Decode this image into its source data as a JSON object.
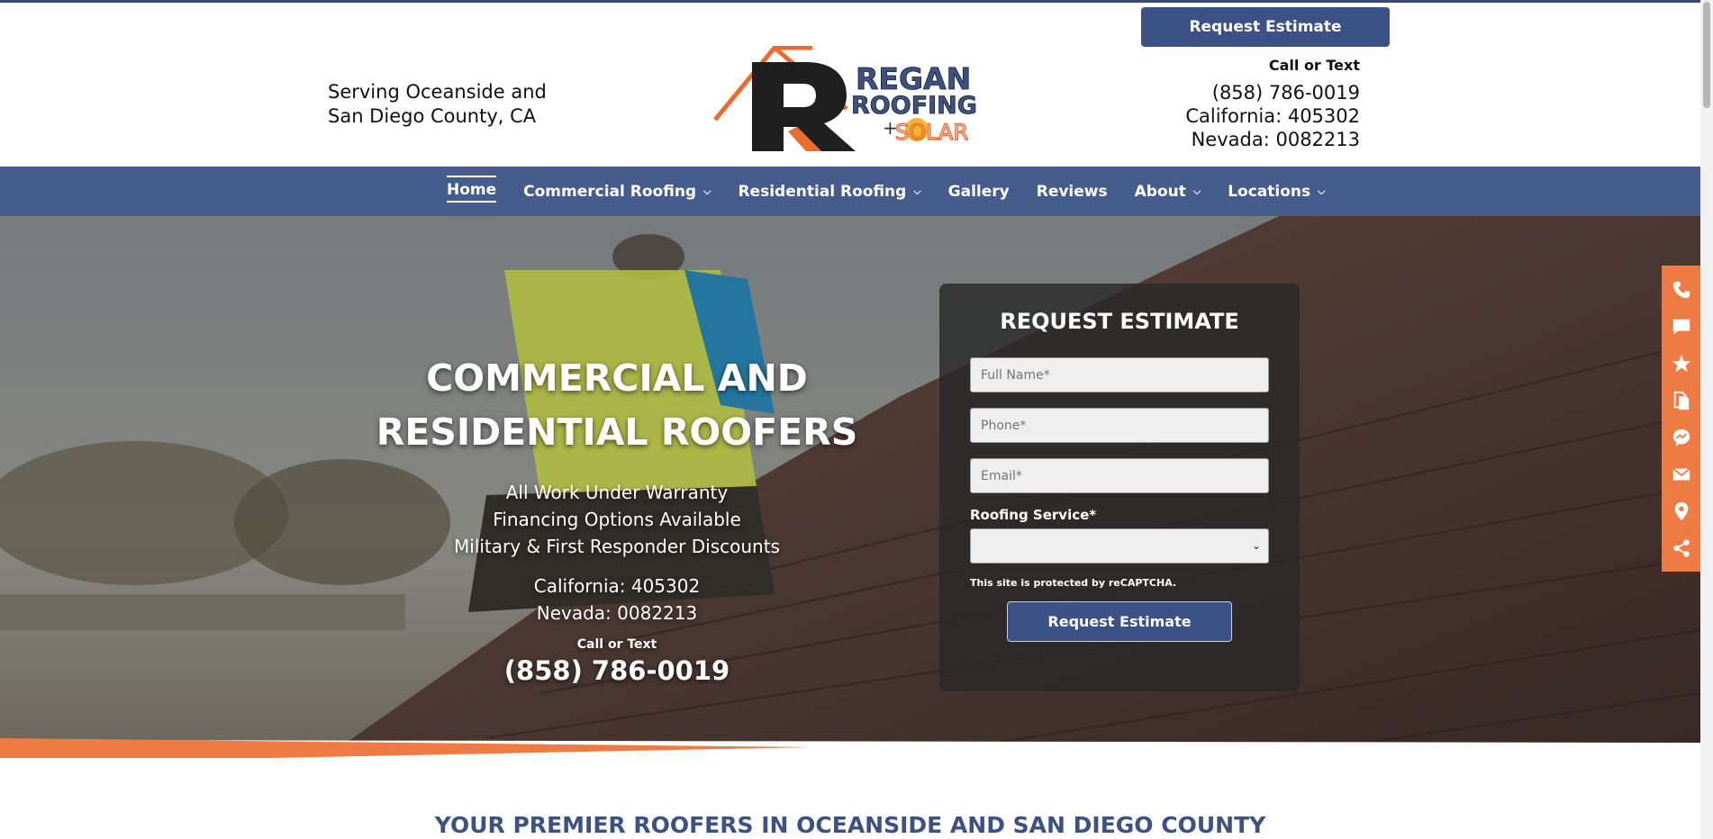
{
  "header": {
    "serving_line1": "Serving Oceanside and",
    "serving_line2": "San Diego County, CA",
    "request_button": "Request Estimate",
    "call_label": "Call or Text",
    "phone": "(858) 786-0019",
    "license_ca": "California: 405302",
    "license_nv": "Nevada: 0082213"
  },
  "logo": {
    "word1": "REGAN",
    "word2": "ROOFING",
    "word3": "SOLAR",
    "plus": "+",
    "colors": {
      "dark": "#1f1f1f",
      "orange": "#ee6a2e",
      "blue": "#3c5185",
      "sun": "#f2b531"
    }
  },
  "nav": {
    "items": [
      {
        "label": "Home",
        "active": true,
        "dropdown": false
      },
      {
        "label": "Commercial Roofing",
        "dropdown": true
      },
      {
        "label": "Residential Roofing",
        "dropdown": true
      },
      {
        "label": "Gallery",
        "dropdown": false
      },
      {
        "label": "Reviews",
        "dropdown": false
      },
      {
        "label": "About",
        "dropdown": true
      },
      {
        "label": "Locations",
        "dropdown": true
      }
    ]
  },
  "hero": {
    "title_line1": "COMMERCIAL AND",
    "title_line2": "RESIDENTIAL ROOFERS",
    "bullet1": "All Work Under Warranty",
    "bullet2": "Financing Options Available",
    "bullet3": "Military & First Responder Discounts",
    "license_ca": "California: 405302",
    "license_nv": "Nevada: 0082213",
    "call_label": "Call or Text",
    "phone": "(858) 786-0019"
  },
  "form": {
    "title": "REQUEST ESTIMATE",
    "name_placeholder": "Full Name*",
    "phone_placeholder": "Phone*",
    "email_placeholder": "Email*",
    "service_label": "Roofing Service*",
    "service_value": "",
    "recaptcha": "This site is protected by reCAPTCHA.",
    "submit": "Request Estimate"
  },
  "float_bar": {
    "icons": [
      "phone-icon",
      "chat-icon",
      "star-icon",
      "document-icon",
      "messenger-icon",
      "email-icon",
      "map-pin-icon",
      "share-icon"
    ]
  },
  "section": {
    "title": "YOUR PREMIER ROOFERS IN OCEANSIDE AND SAN DIEGO COUNTY"
  },
  "colors": {
    "nav_blue": "#465c8d",
    "button_blue": "#3c5185",
    "accent_orange": "#ee7b43"
  }
}
